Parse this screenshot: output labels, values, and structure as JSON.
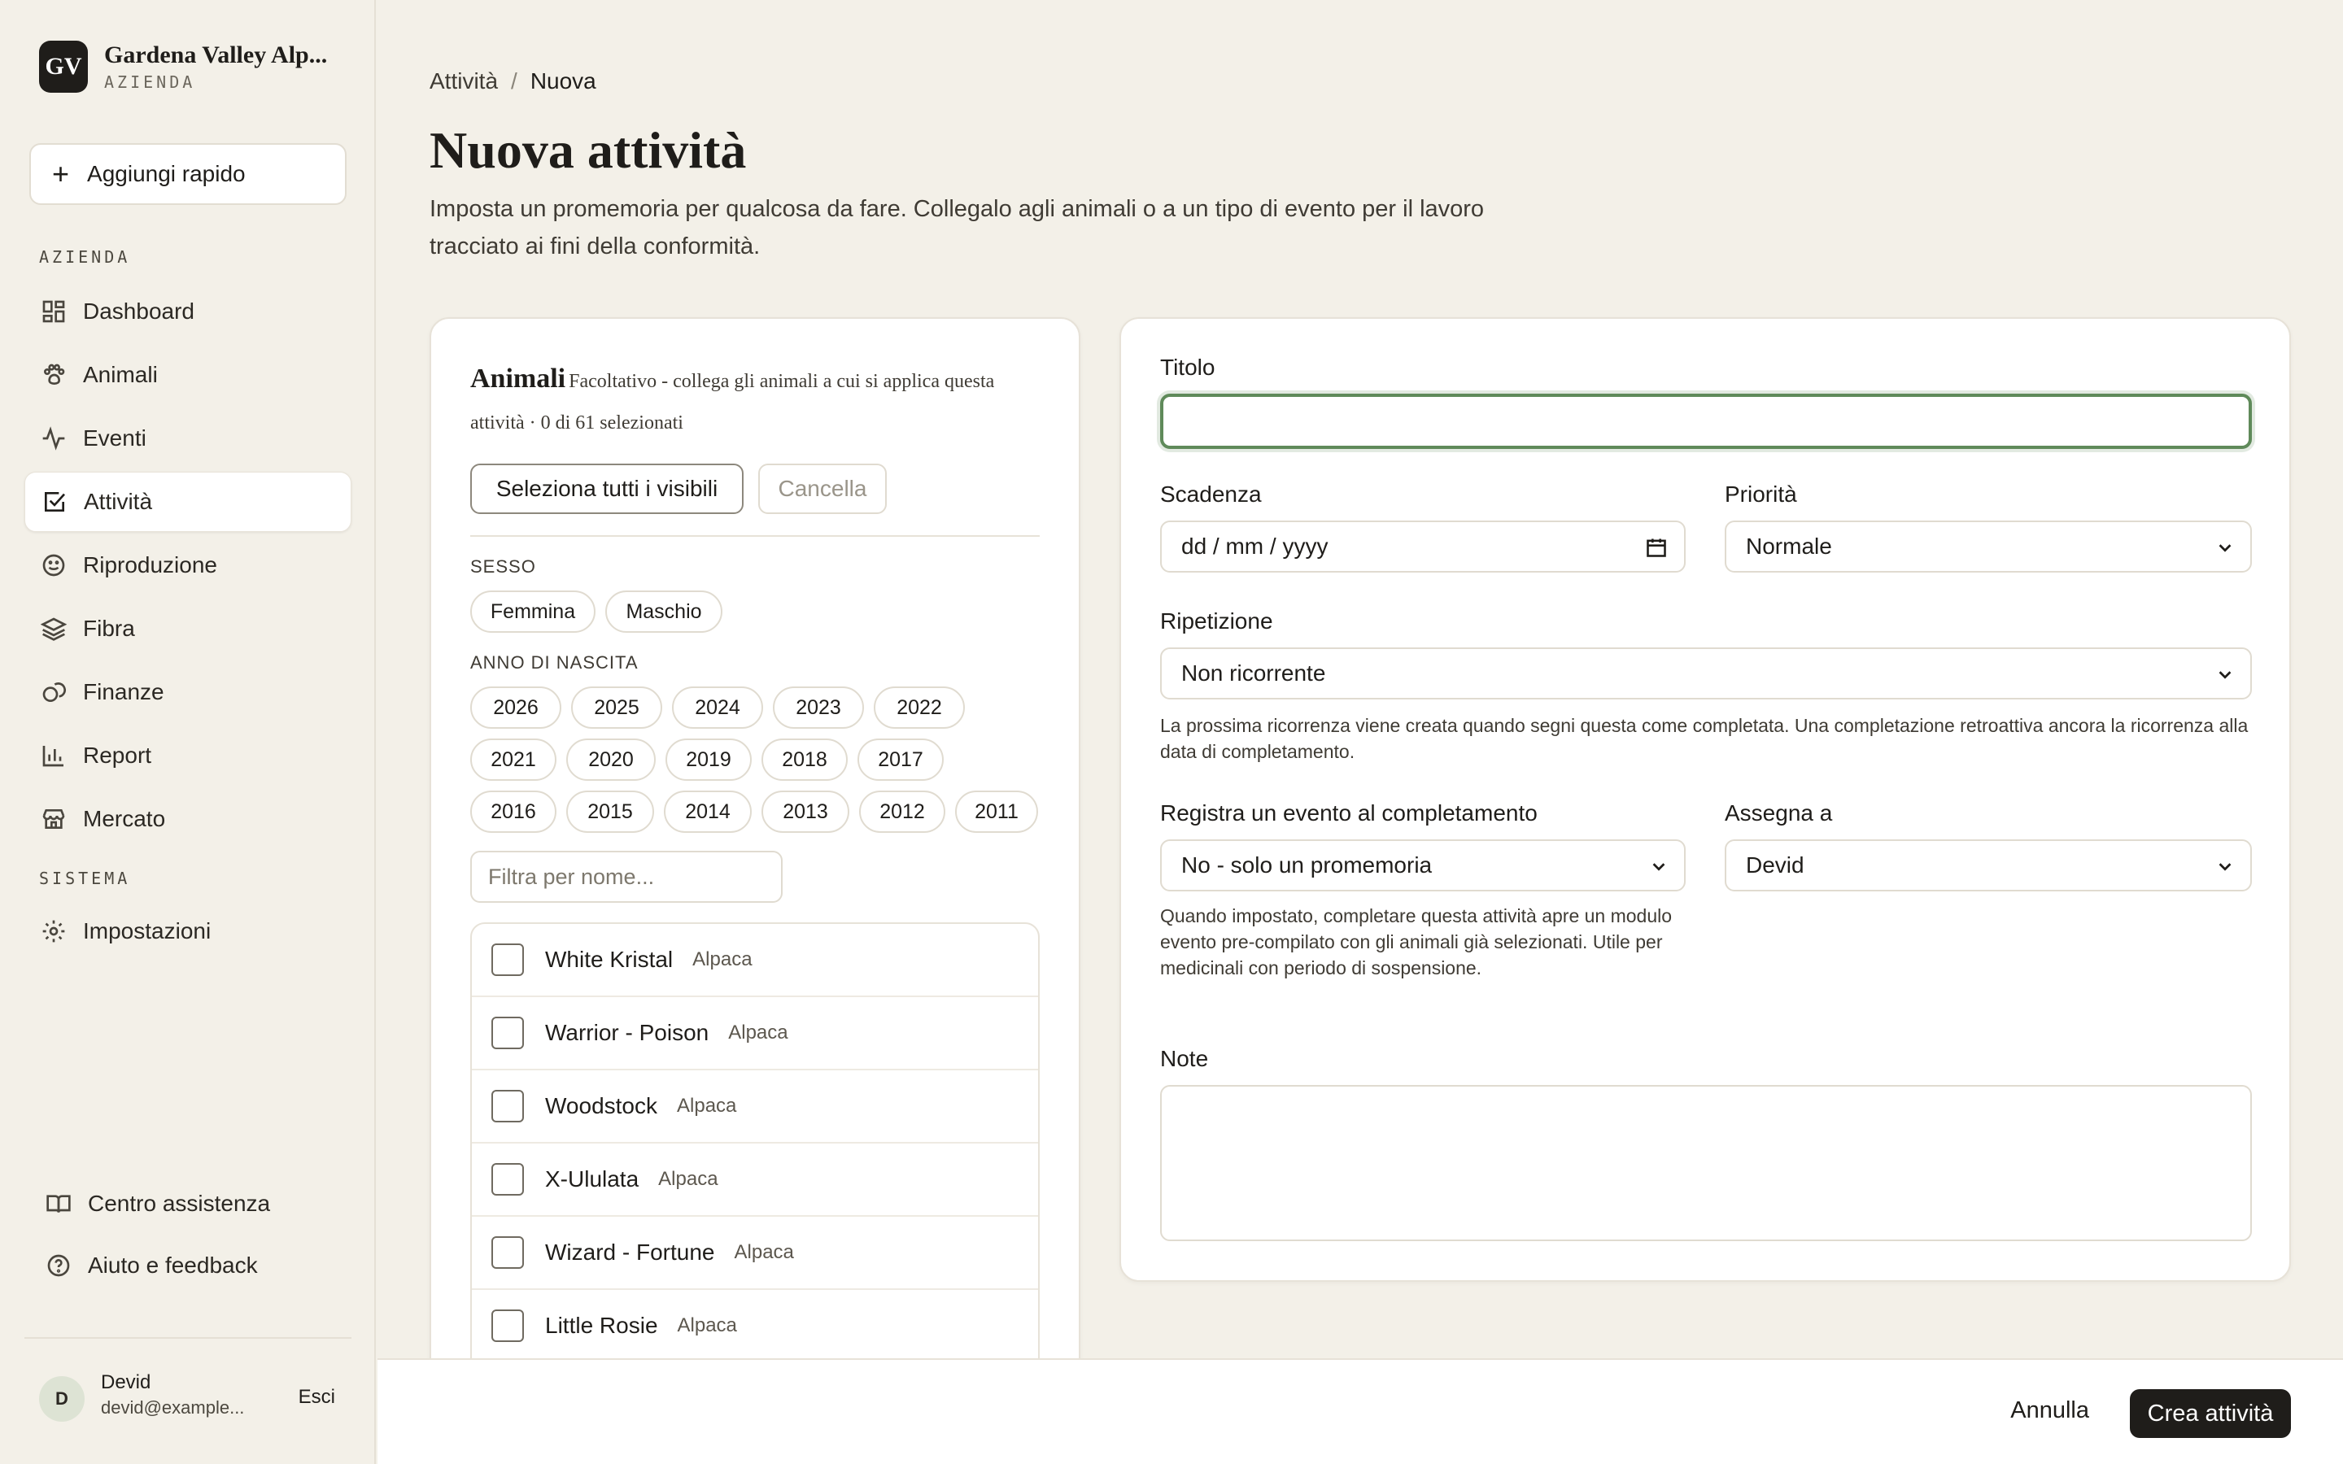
{
  "brand": {
    "logo": "GV",
    "name": "Gardena Valley Alp...",
    "subtitle": "AZIENDA"
  },
  "quick_add": {
    "label": "Aggiungi rapido",
    "icon": "plus-icon"
  },
  "sidebar": {
    "section_farm": "AZIENDA",
    "items": [
      {
        "label": "Dashboard",
        "icon": "dashboard-icon"
      },
      {
        "label": "Animali",
        "icon": "paw-icon"
      },
      {
        "label": "Eventi",
        "icon": "pulse-icon"
      },
      {
        "label": "Attività",
        "icon": "check-square-icon",
        "active": true
      },
      {
        "label": "Riproduzione",
        "icon": "smile-icon"
      },
      {
        "label": "Fibra",
        "icon": "layers-icon"
      },
      {
        "label": "Finanze",
        "icon": "coins-icon"
      },
      {
        "label": "Report",
        "icon": "bar-chart-icon"
      },
      {
        "label": "Mercato",
        "icon": "store-icon"
      }
    ],
    "section_system": "SISTEMA",
    "settings": {
      "label": "Impostazioni",
      "icon": "gear-icon"
    },
    "help_center": "Centro assistenza",
    "feedback": "Aiuto e feedback"
  },
  "user": {
    "initial": "D",
    "name": "Devid",
    "email": "devid@example...",
    "logout": "Esci"
  },
  "breadcrumb": {
    "parent": "Attività",
    "separator": "/",
    "current": "Nuova"
  },
  "page": {
    "title": "Nuova attività",
    "description": "Imposta un promemoria per qualcosa da fare. Collegalo agli animali o a un tipo di evento per il lavoro tracciato ai fini della conformità."
  },
  "animals": {
    "title": "Animali",
    "subtitle": "Facoltativo - collega gli animali a cui si applica questa attività · 0 di 61 selezionati",
    "select_all": "Seleziona tutti i visibili",
    "clear": "Cancella",
    "sex_label": "SESSO",
    "sex_options": [
      "Femmina",
      "Maschio"
    ],
    "year_label": "ANNO DI NASCITA",
    "years": [
      "2026",
      "2025",
      "2024",
      "2023",
      "2022",
      "2021",
      "2020",
      "2019",
      "2018",
      "2017",
      "2016",
      "2015",
      "2014",
      "2013",
      "2012",
      "2011"
    ],
    "name_filter_placeholder": "Filtra per nome...",
    "list": [
      {
        "name": "White Kristal",
        "species": "Alpaca"
      },
      {
        "name": "Warrior - Poison",
        "species": "Alpaca"
      },
      {
        "name": "Woodstock",
        "species": "Alpaca"
      },
      {
        "name": "X-Ululata",
        "species": "Alpaca"
      },
      {
        "name": "Wizard - Fortune",
        "species": "Alpaca"
      },
      {
        "name": "Little Rosie",
        "species": "Alpaca"
      }
    ]
  },
  "form": {
    "title_label": "Titolo",
    "title_value": "",
    "due_label": "Scadenza",
    "due_placeholder": "dd / mm / yyyy",
    "priority_label": "Priorità",
    "priority_value": "Normale",
    "repeat_label": "Ripetizione",
    "repeat_value": "Non ricorrente",
    "repeat_hint": "La prossima ricorrenza viene creata quando segni questa come completata. Una completazione retroattiva ancora la ricorrenza alla data di completamento.",
    "event_label": "Registra un evento al completamento",
    "event_value": "No - solo un promemoria",
    "event_hint": "Quando impostato, completare questa attività apre un modulo evento pre-compilato con gli animali già selezionati. Utile per medicinali con periodo di sospensione.",
    "assign_label": "Assegna a",
    "assign_value": "Devid",
    "notes_label": "Note"
  },
  "actions": {
    "cancel": "Annulla",
    "create": "Crea attività"
  },
  "colors": {
    "accent": "#5f8a5a",
    "primary": "#1f1d1a",
    "background": "#f3f0e8"
  }
}
